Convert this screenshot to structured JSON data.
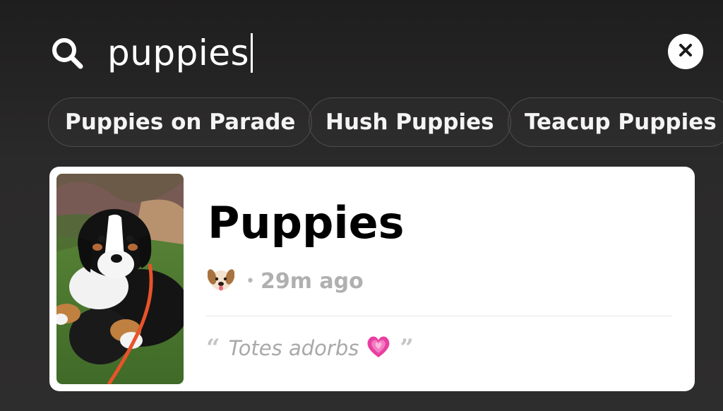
{
  "search": {
    "query": "puppies",
    "icon": "search-icon",
    "clear_icon": "close-icon"
  },
  "suggestions": [
    {
      "label": "Puppies on Parade"
    },
    {
      "label": "Hush Puppies"
    },
    {
      "label": "Teacup Puppies"
    }
  ],
  "result": {
    "title": "Puppies",
    "emoji_icon": "dog-face-icon",
    "time_ago": "29m ago",
    "quote_open": "“",
    "quote": "Totes adorbs",
    "heart_icon": "growing-heart-icon",
    "quote_close": "”"
  },
  "colors": {
    "background": "#2b2a2a",
    "card": "#ffffff",
    "chip_border": "#4d4c4c",
    "muted_text": "#b0b0b0",
    "heart": "#e83fa0"
  }
}
